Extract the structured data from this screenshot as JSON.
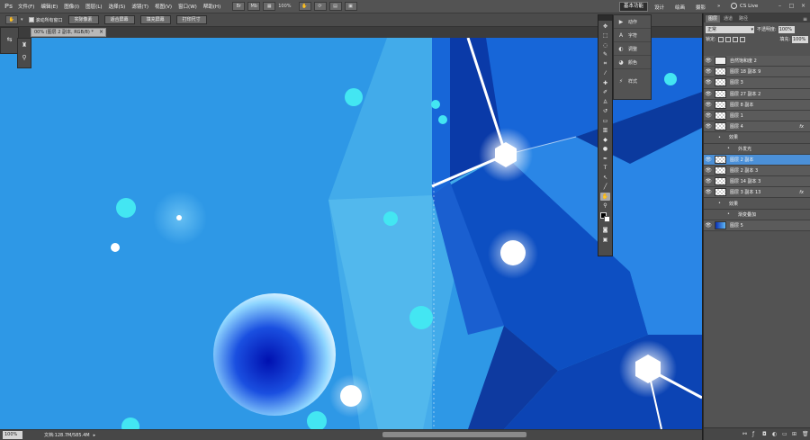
{
  "app": {
    "logo": "Ps"
  },
  "menu": [
    "文件(F)",
    "编辑(E)",
    "图像(I)",
    "图层(L)",
    "选择(S)",
    "滤镜(T)",
    "视图(V)",
    "窗口(W)",
    "帮助(H)"
  ],
  "menubar": {
    "zoom": "100%",
    "workspaces": {
      "active": "基本功能",
      "items": [
        "设计",
        "绘画",
        "摄影"
      ]
    },
    "cs_live": "CS Live",
    "more": "»"
  },
  "options": {
    "scroll_all": "滚动所有窗口",
    "buttons": [
      "实际像素",
      "适合屏幕",
      "填充屏幕",
      "打印尺寸"
    ]
  },
  "document": {
    "tab_title": "00% (图层 2 副本, RGB/8) *",
    "close": "×"
  },
  "status": {
    "zoom": "100%",
    "doc_size": "文档:128.7M/585.4M"
  },
  "side_panel": [
    "动作",
    "字符",
    "调整",
    "颜色",
    "样式"
  ],
  "layers_panel": {
    "tabs": [
      "图层",
      "通道",
      "路径"
    ],
    "blend_mode": "正常",
    "opacity_label": "不透明度:",
    "opacity": "100%",
    "lock_label": "锁定:",
    "fill_label": "填充:",
    "fill": "100%",
    "layers": [
      {
        "name": "自然饱和度 2",
        "kind": "adjustment",
        "fx": false
      },
      {
        "name": "图层 18 副本 9",
        "kind": "layer",
        "fx": false
      },
      {
        "name": "图层 3",
        "kind": "layer",
        "fx": false
      },
      {
        "name": "图层 27 副本 2",
        "kind": "layer",
        "fx": false
      },
      {
        "name": "图层 8 副本",
        "kind": "layer",
        "fx": false
      },
      {
        "name": "图层 1",
        "kind": "layer",
        "fx": false
      },
      {
        "name": "图层 4",
        "kind": "layer",
        "fx": true
      },
      {
        "name": "效果",
        "kind": "effects",
        "fx": false
      },
      {
        "name": "外发光",
        "kind": "effect",
        "fx": false
      },
      {
        "name": "图层 2 副本",
        "kind": "layer",
        "fx": false,
        "selected": true
      },
      {
        "name": "图层 2 副本 3",
        "kind": "layer",
        "fx": false
      },
      {
        "name": "图层 14 副本 3",
        "kind": "layer",
        "fx": false
      },
      {
        "name": "图层 3 副本 13",
        "kind": "layer",
        "fx": true
      },
      {
        "name": "效果",
        "kind": "effects",
        "fx": false
      },
      {
        "name": "渐变叠加",
        "kind": "effect",
        "fx": false
      },
      {
        "name": "图层 5",
        "kind": "layer",
        "fx": false
      }
    ],
    "fx_label": "fx"
  },
  "colors": {
    "canvas_blue": "#2f9ae8",
    "selected_layer": "#4b90d8"
  }
}
